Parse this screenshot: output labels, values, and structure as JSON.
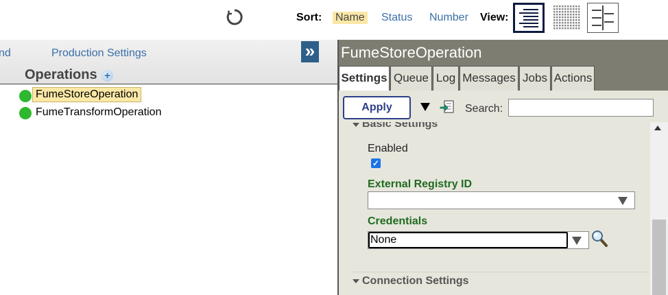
{
  "toolbar": {
    "refresh_icon": "refresh-icon",
    "sort_label": "Sort:",
    "sort_options": [
      "Name",
      "Status",
      "Number"
    ],
    "sort_selected": "Name",
    "view_label": "View:",
    "view_modes": [
      "list-view-icon",
      "grid-view-icon",
      "split-view-icon"
    ]
  },
  "left": {
    "tabs": [
      "nd",
      "Production Settings"
    ],
    "expand_symbol": "»",
    "section_title": "Operations",
    "add_symbol": "+",
    "operations": [
      {
        "name": "FumeStoreOperation",
        "status_color": "#2db82d",
        "selected": true
      },
      {
        "name": "FumeTransformOperation",
        "status_color": "#2db82d",
        "selected": false
      }
    ]
  },
  "right": {
    "title": "FumeStoreOperation",
    "tabs": [
      "Settings",
      "Queue",
      "Log",
      "Messages",
      "Jobs",
      "Actions"
    ],
    "active_tab": "Settings",
    "apply_label": "Apply",
    "search_label": "Search:",
    "search_value": "",
    "sections": {
      "basic": "Basic Settings",
      "connection": "Connection Settings"
    },
    "fields": {
      "enabled_label": "Enabled",
      "enabled_checked": true,
      "external_registry_label": "External Registry ID",
      "external_registry_value": "",
      "credentials_label": "Credentials",
      "credentials_value": "None"
    }
  },
  "colors": {
    "accent_blue": "#3a6fa8",
    "highlight": "#fbe8a6",
    "status_ok": "#2db82d",
    "panel_header": "#7d7d71",
    "field_green": "#206b20"
  }
}
